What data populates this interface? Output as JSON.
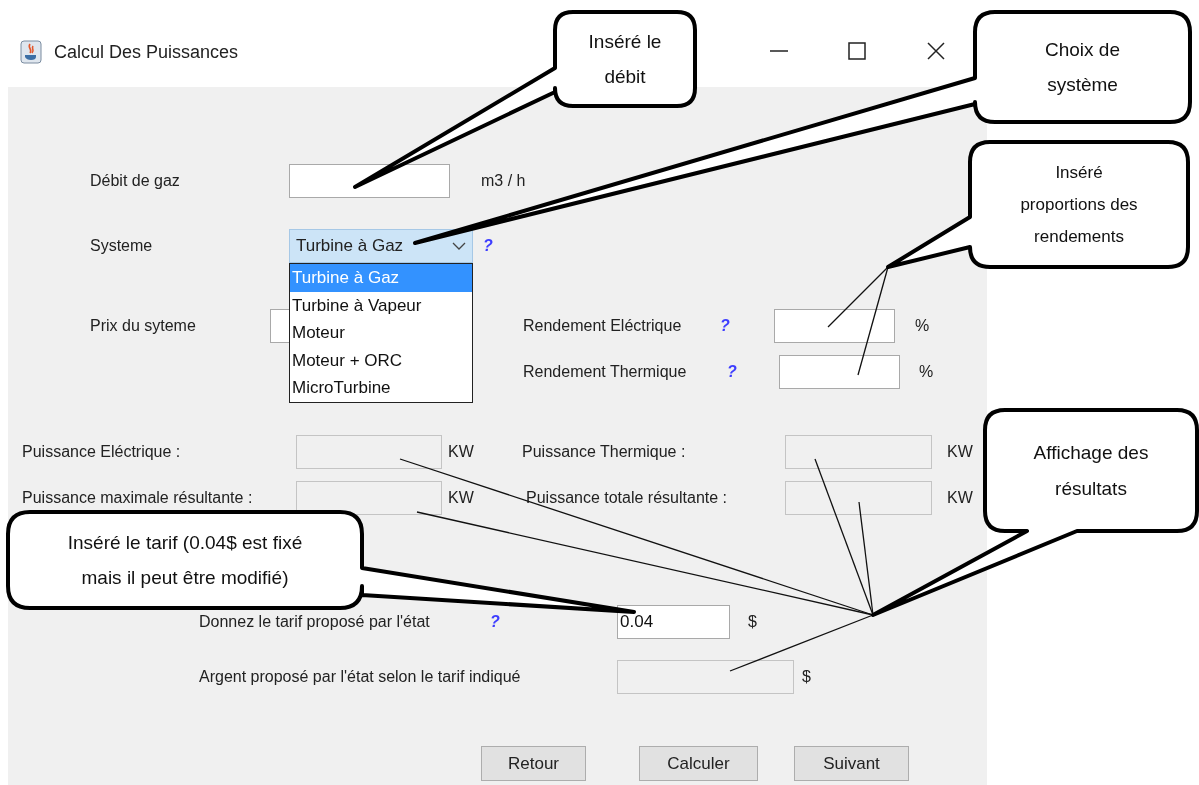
{
  "window": {
    "title": "Calcul Des Puissances"
  },
  "form": {
    "gas_flow": {
      "label": "Débit de gaz",
      "unit": "m3 / h",
      "disabled": false
    },
    "system": {
      "label": "Systeme",
      "value": "Turbine à Gaz",
      "help": "?",
      "expanded": true,
      "options": [
        {
          "label": "Turbine à Gaz",
          "selected": true
        },
        {
          "label": "Turbine à Vapeur",
          "selected": false
        },
        {
          "label": "Moteur",
          "selected": false
        },
        {
          "label": "Moteur  + ORC",
          "selected": false
        },
        {
          "label": "MicroTurbine",
          "selected": false
        }
      ]
    },
    "system_price": {
      "label": "Prix du syteme",
      "disabled": false
    },
    "electric_efficiency": {
      "label": "Rendement Eléctrique",
      "help": "?",
      "unit": "%",
      "disabled": false
    },
    "thermal_efficiency": {
      "label": "Rendement Thermique",
      "help": "?",
      "unit": "%",
      "disabled": false
    },
    "electric_power": {
      "label": "Puissance Eléctrique :",
      "unit": "KW",
      "disabled": true
    },
    "thermal_power": {
      "label": "Puissance Thermique :",
      "unit": "KW",
      "disabled": true
    },
    "max_power": {
      "label": "Puissance maximale résultante :",
      "unit": "KW",
      "disabled": true
    },
    "total_power": {
      "label": "Puissance totale résultante :",
      "unit": "KW",
      "disabled": true
    },
    "tariff": {
      "label": "Donnez le tarif proposé par l'état",
      "help": "?",
      "value": "0.04",
      "unit": "$",
      "disabled": false
    },
    "money": {
      "label": "Argent proposé par l'état selon le tarif indiqué",
      "unit": "$",
      "disabled": true
    }
  },
  "buttons": [
    {
      "label": "Retour"
    },
    {
      "label": "Calculer"
    },
    {
      "label": "Suivant"
    }
  ],
  "callouts": [
    {
      "text": "Inséré le\ndébit"
    },
    {
      "text": "Choix de\nsystème"
    },
    {
      "text": "Inséré\nproportions des\nrendements"
    },
    {
      "text": "Affichage des\nrésultats"
    },
    {
      "text": "Inséré le tarif (0.04$ est fixé\nmais il peut être modifié)"
    }
  ]
}
